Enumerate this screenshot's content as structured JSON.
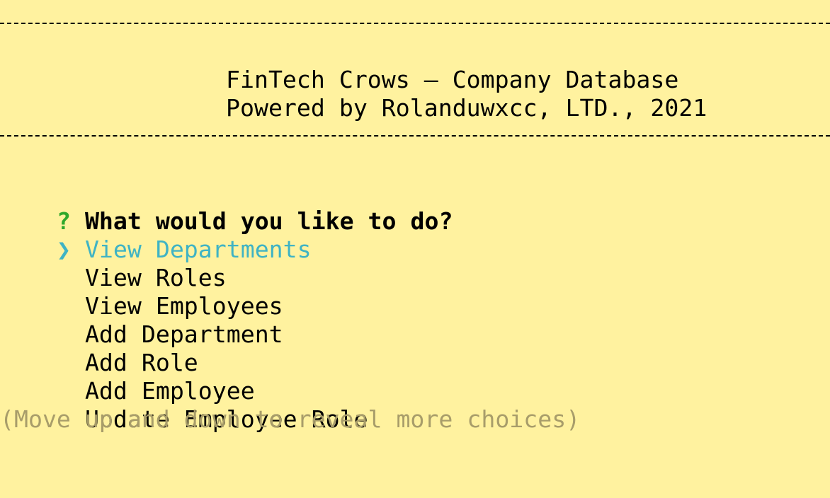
{
  "banner": {
    "title": "FinTech Crows – Company Database",
    "subtitle": "Powered by Rolanduwxcc, LTD., 2021"
  },
  "prompt": {
    "marker": "?",
    "question": "What would you like to do?",
    "pointer": "❯",
    "choices": [
      "View Departments",
      "View Roles",
      "View Employees",
      "Add Department",
      "Add Role",
      "Add Employee",
      "Update Employee Role"
    ],
    "hint": "(Move up and down to reveal more choices)"
  },
  "colors": {
    "background": "#fff29f",
    "marker": "#2fa82b",
    "selected": "#3fb3c4",
    "hint": "#a89d6a"
  }
}
